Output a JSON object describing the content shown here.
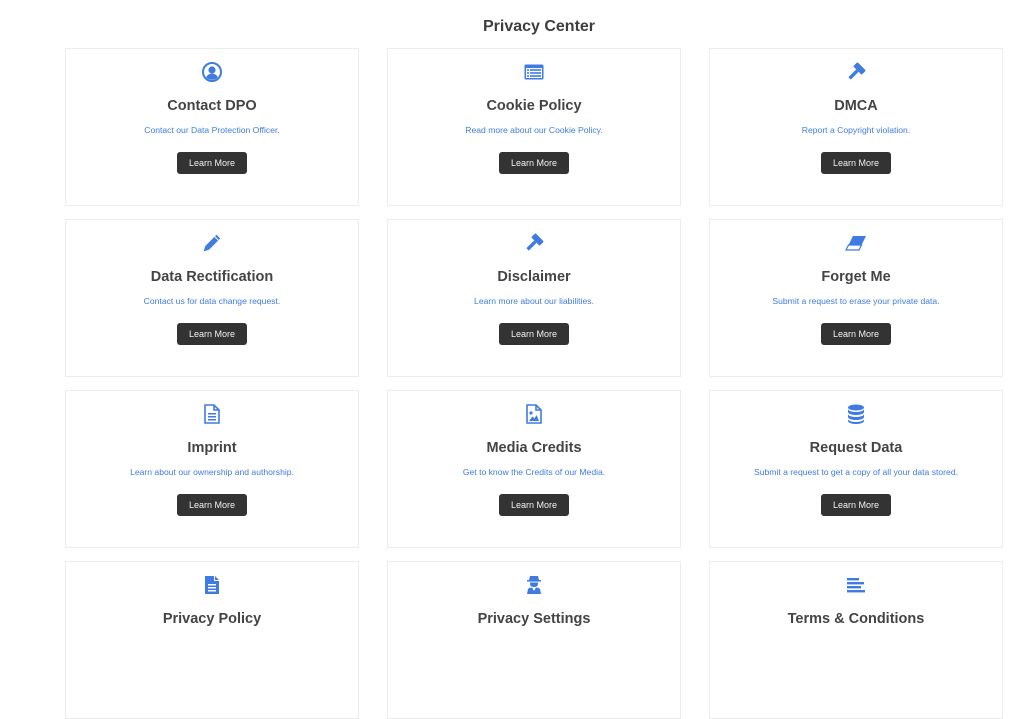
{
  "page": {
    "title": "Privacy Center",
    "accent_color": "#3f7be0",
    "button_color": "#333333"
  },
  "cards": [
    {
      "title": "Contact DPO",
      "description": "Contact our Data Protection Officer.",
      "button": "Learn More",
      "icon": "user-circle-icon"
    },
    {
      "title": "Cookie Policy",
      "description": "Read more about our Cookie Policy.",
      "button": "Learn More",
      "icon": "list-alt-icon"
    },
    {
      "title": "DMCA",
      "description": "Report a Copyright violation.",
      "button": "Learn More",
      "icon": "gavel-icon"
    },
    {
      "title": "Data Rectification",
      "description": "Contact us for data change request.",
      "button": "Learn More",
      "icon": "pencil-icon"
    },
    {
      "title": "Disclaimer",
      "description": "Learn more about our liabilities.",
      "button": "Learn More",
      "icon": "gavel-icon"
    },
    {
      "title": "Forget Me",
      "description": "Submit a request to erase your private data.",
      "button": "Learn More",
      "icon": "eraser-icon"
    },
    {
      "title": "Imprint",
      "description": "Learn about our ownership and authorship.",
      "button": "Learn More",
      "icon": "file-text-outline-icon"
    },
    {
      "title": "Media Credits",
      "description": "Get to know the Credits of our Media.",
      "button": "Learn More",
      "icon": "file-image-icon"
    },
    {
      "title": "Request Data",
      "description": "Submit a request to get a copy of all your data stored.",
      "button": "Learn More",
      "icon": "database-icon"
    },
    {
      "title": "Privacy Policy",
      "description": "",
      "button": "",
      "icon": "file-text-icon"
    },
    {
      "title": "Privacy Settings",
      "description": "",
      "button": "",
      "icon": "user-secret-icon"
    },
    {
      "title": "Terms & Conditions",
      "description": "",
      "button": "",
      "icon": "align-left-icon"
    }
  ]
}
